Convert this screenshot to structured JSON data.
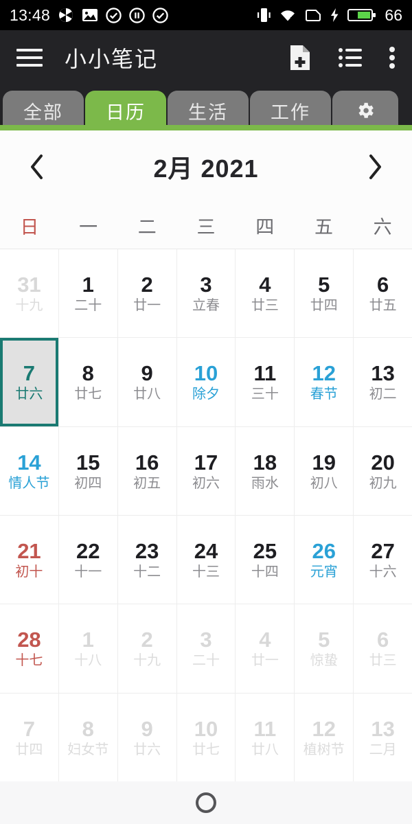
{
  "status_bar": {
    "time": "13:48",
    "battery_level": "66",
    "left_icons": [
      "shutter-icon",
      "gallery-icon",
      "check-circle-icon",
      "pause-circle-icon",
      "check-circle-icon"
    ],
    "right_icons": [
      "vibrate-icon",
      "wifi-icon",
      "sim-icon",
      "charging-bolt-icon",
      "battery-icon"
    ],
    "battery_color": "#5cd44a"
  },
  "app_bar": {
    "menu_icon": "hamburger-menu-icon",
    "title": "小小笔记",
    "actions": [
      "new-note-icon",
      "list-view-icon",
      "overflow-menu-icon"
    ]
  },
  "tabs": {
    "items": [
      {
        "label": "全部",
        "active": false
      },
      {
        "label": "日历",
        "active": true
      },
      {
        "label": "生活",
        "active": false
      },
      {
        "label": "工作",
        "active": false
      },
      {
        "label": "",
        "active": false,
        "icon": "gear-icon"
      }
    ],
    "active_color": "#7cb94a",
    "inactive_color": "#7b7b7b"
  },
  "month_header": {
    "prev_label": "prev-month-icon",
    "title": "2月 2021",
    "next_label": "next-month-icon"
  },
  "weekdays": [
    {
      "label": "日",
      "sunday": true
    },
    {
      "label": "一",
      "sunday": false
    },
    {
      "label": "二",
      "sunday": false
    },
    {
      "label": "三",
      "sunday": false
    },
    {
      "label": "四",
      "sunday": false
    },
    {
      "label": "五",
      "sunday": false
    },
    {
      "label": "六",
      "sunday": false
    }
  ],
  "calendar": {
    "selected_date": "7",
    "colors": {
      "blue": "#2aa1d6",
      "red": "#c2564f",
      "selected_border": "#1a7a72",
      "selected_bg": "#e1e1e1"
    },
    "rows": [
      [
        {
          "day": "31",
          "lunar": "十九",
          "state": "out"
        },
        {
          "day": "1",
          "lunar": "二十",
          "state": "normal"
        },
        {
          "day": "2",
          "lunar": "廿一",
          "state": "normal"
        },
        {
          "day": "3",
          "lunar": "立春",
          "state": "normal"
        },
        {
          "day": "4",
          "lunar": "廿三",
          "state": "normal"
        },
        {
          "day": "5",
          "lunar": "廿四",
          "state": "normal"
        },
        {
          "day": "6",
          "lunar": "廿五",
          "state": "normal"
        }
      ],
      [
        {
          "day": "7",
          "lunar": "廿六",
          "state": "selected"
        },
        {
          "day": "8",
          "lunar": "廿七",
          "state": "normal"
        },
        {
          "day": "9",
          "lunar": "廿八",
          "state": "normal"
        },
        {
          "day": "10",
          "lunar": "除夕",
          "state": "blue"
        },
        {
          "day": "11",
          "lunar": "三十",
          "state": "normal"
        },
        {
          "day": "12",
          "lunar": "春节",
          "state": "blue"
        },
        {
          "day": "13",
          "lunar": "初二",
          "state": "normal"
        }
      ],
      [
        {
          "day": "14",
          "lunar": "情人节",
          "state": "blue"
        },
        {
          "day": "15",
          "lunar": "初四",
          "state": "normal"
        },
        {
          "day": "16",
          "lunar": "初五",
          "state": "normal"
        },
        {
          "day": "17",
          "lunar": "初六",
          "state": "normal"
        },
        {
          "day": "18",
          "lunar": "雨水",
          "state": "normal"
        },
        {
          "day": "19",
          "lunar": "初八",
          "state": "normal"
        },
        {
          "day": "20",
          "lunar": "初九",
          "state": "normal"
        }
      ],
      [
        {
          "day": "21",
          "lunar": "初十",
          "state": "red"
        },
        {
          "day": "22",
          "lunar": "十一",
          "state": "normal"
        },
        {
          "day": "23",
          "lunar": "十二",
          "state": "normal"
        },
        {
          "day": "24",
          "lunar": "十三",
          "state": "normal"
        },
        {
          "day": "25",
          "lunar": "十四",
          "state": "normal"
        },
        {
          "day": "26",
          "lunar": "元宵",
          "state": "blue"
        },
        {
          "day": "27",
          "lunar": "十六",
          "state": "normal"
        }
      ],
      [
        {
          "day": "28",
          "lunar": "十七",
          "state": "red"
        },
        {
          "day": "1",
          "lunar": "十八",
          "state": "out"
        },
        {
          "day": "2",
          "lunar": "十九",
          "state": "out"
        },
        {
          "day": "3",
          "lunar": "二十",
          "state": "out"
        },
        {
          "day": "4",
          "lunar": "廿一",
          "state": "out"
        },
        {
          "day": "5",
          "lunar": "惊蛰",
          "state": "out"
        },
        {
          "day": "6",
          "lunar": "廿三",
          "state": "out"
        }
      ],
      [
        {
          "day": "7",
          "lunar": "廿四",
          "state": "out"
        },
        {
          "day": "8",
          "lunar": "妇女节",
          "state": "out"
        },
        {
          "day": "9",
          "lunar": "廿六",
          "state": "out"
        },
        {
          "day": "10",
          "lunar": "廿七",
          "state": "out"
        },
        {
          "day": "11",
          "lunar": "廿八",
          "state": "out"
        },
        {
          "day": "12",
          "lunar": "植树节",
          "state": "out"
        },
        {
          "day": "13",
          "lunar": "二月",
          "state": "out"
        }
      ]
    ]
  },
  "nav_bar": {
    "home_icon": "home-circle-icon"
  }
}
